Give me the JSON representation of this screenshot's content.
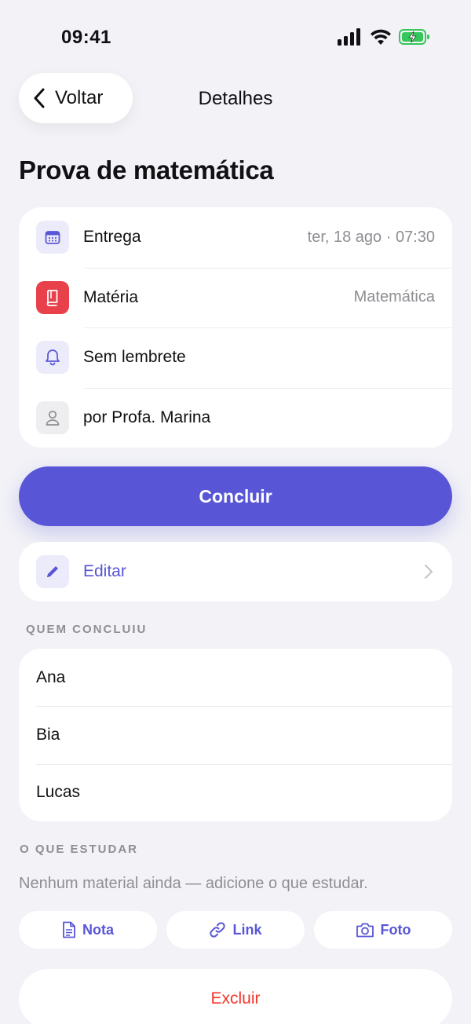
{
  "status_bar": {
    "time": "09:41",
    "icons": [
      "cellular-signal-icon",
      "wifi-icon",
      "battery-charging-icon"
    ],
    "battery_color": "#34C759"
  },
  "nav": {
    "back_label": "Voltar",
    "title": "Detalhes"
  },
  "task": {
    "title": "Prova de matemática"
  },
  "details": [
    {
      "icon": "calendar-icon",
      "label": "Entrega",
      "value": "ter, 18 ago · 07:30"
    },
    {
      "icon": "book-icon",
      "label": "Matéria",
      "value": "Matemática",
      "icon_color": "#E8414B"
    },
    {
      "icon": "bell-icon",
      "label": "Sem lembrete",
      "value": ""
    },
    {
      "icon": "person-icon",
      "label": "por Profa. Marina",
      "value": ""
    }
  ],
  "actions": {
    "complete_label": "Concluir",
    "edit_label": "Editar",
    "delete_label": "Excluir"
  },
  "completed_by": {
    "header": "QUEM CONCLUIU",
    "people": [
      "Ana",
      "Bia",
      "Lucas"
    ]
  },
  "study": {
    "header": "O QUE ESTUDAR",
    "empty_text": "Nenhum material ainda — adicione o que estudar.",
    "add_buttons": [
      {
        "icon": "document-icon",
        "label": "Nota"
      },
      {
        "icon": "link-icon",
        "label": "Link"
      },
      {
        "icon": "camera-icon",
        "label": "Foto"
      }
    ]
  },
  "colors": {
    "accent": "#5856D6",
    "destructive": "#F2352C",
    "background": "#F2F2F7",
    "secondary_text": "#8E8E93"
  }
}
